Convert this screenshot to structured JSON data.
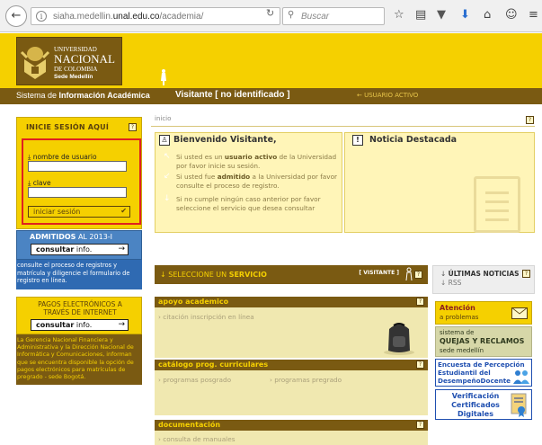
{
  "browser": {
    "url_prefix": "siaha.medellin.",
    "url_domain": "unal.edu.co",
    "url_path": "/academia/",
    "search_placeholder": "Buscar"
  },
  "header": {
    "logo_line1": "UNIVERSIDAD",
    "logo_line2": "NACIONAL",
    "logo_line3": "DE COLOMBIA",
    "logo_line4": "Sede Medellín"
  },
  "navbar": {
    "system_prefix": "Sistema de ",
    "system_bold": "Información Académica",
    "visitor": "Visitante [ no identificado ]",
    "user_status": "← USUARIO ACTIVO"
  },
  "login": {
    "title": "INICIE SESIÓN AQUÍ",
    "username_label": "nombre de usuario",
    "password_label": "clave",
    "submit_label": "iniciar sesión",
    "help": "?"
  },
  "admitted": {
    "title_bold": "ADMITIDOS",
    "title_rest": " AL 2013-I",
    "consult_bold": "consultar",
    "consult_rest": " info.",
    "description": "consulte el proceso de registros y matrícula y diligencie el formulario de registro en línea."
  },
  "payments": {
    "title_line1": "PAGOS ELECTRÓNICOS A",
    "title_line2": "TRAVÉS DE INTERNET",
    "consult_bold": "consultar",
    "consult_rest": " info.",
    "description": "La Gerencia Nacional Financiera y Administrativa y la Dirección Nacional de Informática y Comunicaciones, informan que se encuentra disponible la opción de pagos electrónicos para matrículas de pregrado - sede Bogotá."
  },
  "main": {
    "breadcrumb": "inicio",
    "help": "?",
    "welcome_title": "Bienvenido Visitante,",
    "welcome_items": [
      {
        "pre": "Si usted es un ",
        "bold": "usuario activo",
        "post": " de la Universidad por favor inicie su sesión."
      },
      {
        "pre": "Si usted fue ",
        "bold": "admitido",
        "post": " a la Universidad por favor consulte el proceso de registro."
      },
      {
        "pre": "Si no cumple ningún caso anterior por favor seleccione el servicio que desea consultar",
        "bold": "",
        "post": ""
      }
    ],
    "featured_title": "Noticia Destacada"
  },
  "services": {
    "title_pre": "↓ SELECCIONE UN ",
    "title_bold": "SERVICIO",
    "badge": "[ VISITANTE ]",
    "help": "?",
    "sections": [
      {
        "title": "apoyo academico",
        "links": [
          "› citación inscripción en línea"
        ]
      },
      {
        "title": "catálogo prog. curriculares",
        "links": [
          "› programas posgrado",
          "› programas pregrado"
        ]
      },
      {
        "title": "documentación",
        "links": [
          "› consulta de manuales"
        ]
      }
    ]
  },
  "sidebar_right": {
    "news_pre": "↓ ",
    "news_bold": "ÚLTIMAS NOTICIAS",
    "news_rss": "↓ RSS",
    "help": "?",
    "attention_title": "Atención",
    "attention_sub": "a problemas",
    "queja_line1": "sistema de",
    "queja_line2": "QUEJAS Y RECLAMOS",
    "queja_line3": "sede medellín",
    "encuesta_line1": "Encuesta de Percepción",
    "encuesta_line2": "Estudiantil del",
    "encuesta_line3": "DesempeñoDocente",
    "verif_line1": "Verificación",
    "verif_line2": "Certificados",
    "verif_line3": "Digitales"
  },
  "colors": {
    "brand_yellow": "#f5d000",
    "brand_brown": "#7a5a12",
    "highlight_red": "#e0201f",
    "admitted_blue": "#4b84c3"
  }
}
